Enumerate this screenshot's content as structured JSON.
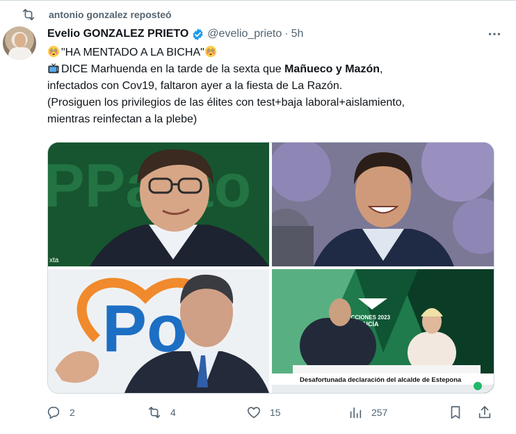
{
  "repost": {
    "text": "antonio gonzalez reposteó",
    "icon": "repost-icon"
  },
  "author": {
    "name": "Evelio GONZALEZ PRIETO",
    "handle": "@evelio_prieto",
    "separator": "·",
    "time": "5h",
    "verified": true
  },
  "tweet": {
    "line1": "\"HA MENTADO A LA BICHA\"",
    "line2_pre": "DICE Marhuenda en la tarde de la sexta que ",
    "line2_bold": "Mañueco y Mazón",
    "line2_post": ",",
    "line3": "infectados con Cov19, faltaron ayer a la fiesta de La Razón.",
    "line4": "(Prosiguen los privilegios de las élites con test+baja laboral+aislamiento,",
    "line5": "mientras reinfectan a la plebe)"
  },
  "media": {
    "img1_tag": "xta",
    "img1_bg_text": "PPacto",
    "img3_bg_text": "Po",
    "img4_banner": "Desafortunada declaración del alcalde de Estepona",
    "img4_logo": "ELECCIONES 2023",
    "img4_logo2": "ANDALUCÍA"
  },
  "actions": {
    "replies": "2",
    "reposts": "4",
    "likes": "15",
    "views": "257"
  },
  "colors": {
    "text": "#0f1419",
    "muted": "#536471",
    "verified": "#1d9bf0",
    "border": "#cfd9de"
  }
}
